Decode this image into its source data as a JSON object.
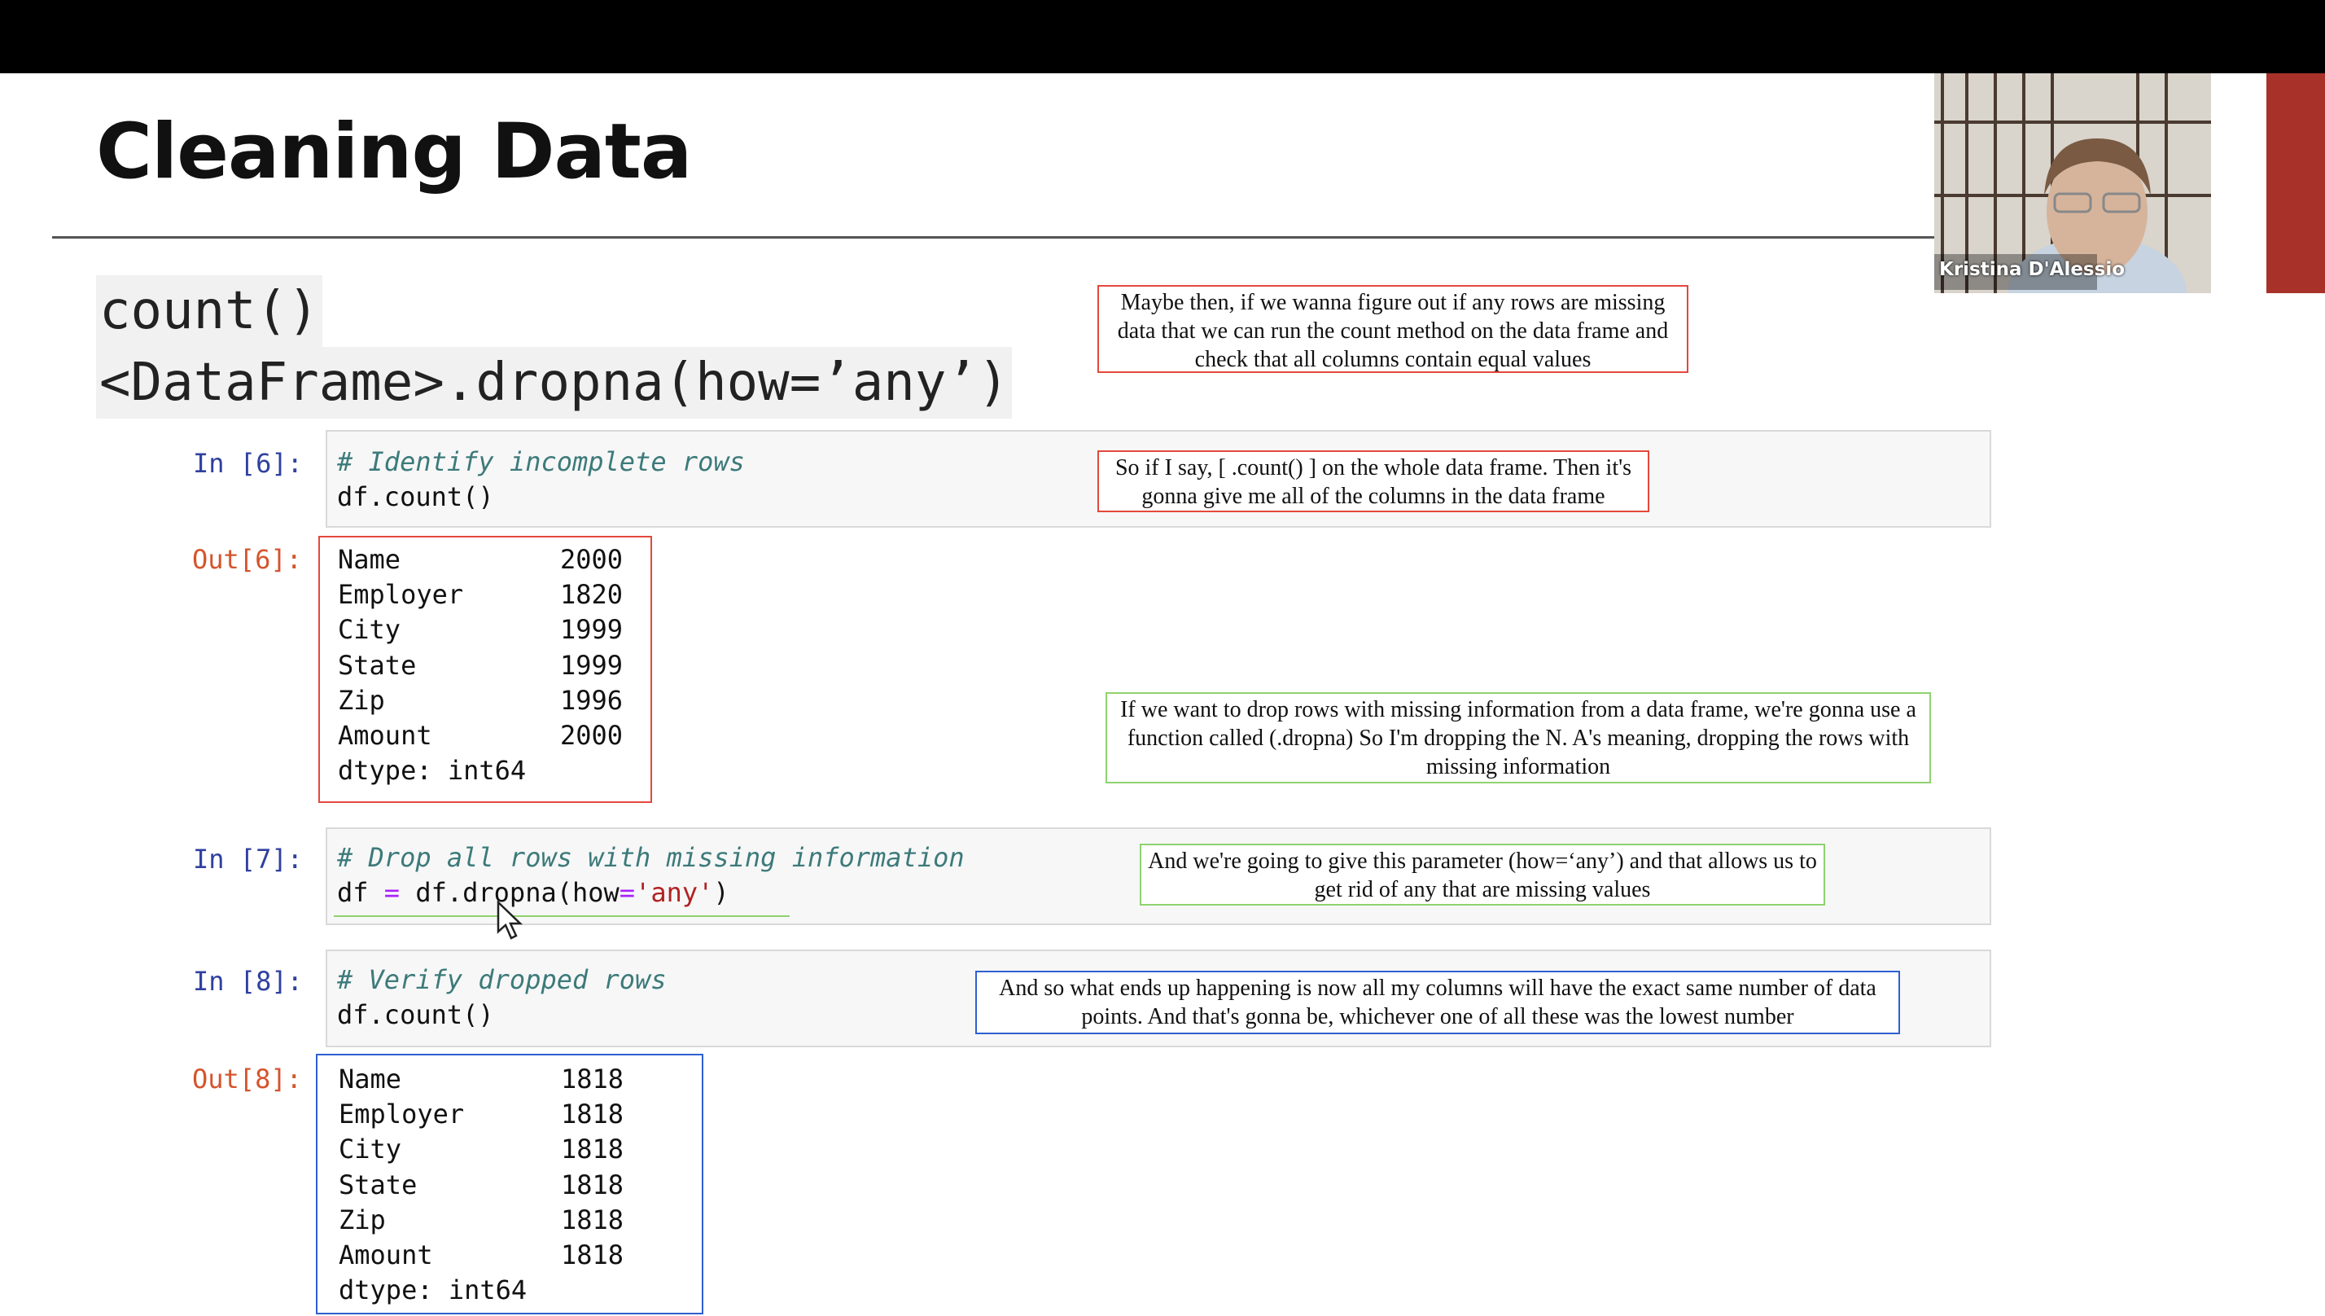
{
  "slide": {
    "title": "Cleaning Data",
    "methods": [
      "count()",
      "<DataFrame>.dropna(how=’any’)"
    ]
  },
  "webcam": {
    "speaker": "Kristina D'Alessio"
  },
  "cells": {
    "in6": {
      "prompt": "In [6]:",
      "comment": "# Identify incomplete rows",
      "code": "df.count()"
    },
    "out6": {
      "prompt": "Out[6]:",
      "rows": [
        {
          "name": "Name",
          "value": "2000"
        },
        {
          "name": "Employer",
          "value": "1820"
        },
        {
          "name": "City",
          "value": "1999"
        },
        {
          "name": "State",
          "value": "1999"
        },
        {
          "name": "Zip",
          "value": "1996"
        },
        {
          "name": "Amount",
          "value": "2000"
        }
      ],
      "dtype": "dtype: int64"
    },
    "in7": {
      "prompt": "In [7]:",
      "comment": "# Drop all rows with missing information",
      "code_var": "df",
      "code_op": "=",
      "code_call": "df.dropna(how",
      "code_eq": "=",
      "code_str": "'any'",
      "code_close": ")"
    },
    "in8": {
      "prompt": "In [8]:",
      "comment": "# Verify dropped rows",
      "code": "df.count()"
    },
    "out8": {
      "prompt": "Out[8]:",
      "rows": [
        {
          "name": "Name",
          "value": "1818"
        },
        {
          "name": "Employer",
          "value": "1818"
        },
        {
          "name": "City",
          "value": "1818"
        },
        {
          "name": "State",
          "value": "1818"
        },
        {
          "name": "Zip",
          "value": "1818"
        },
        {
          "name": "Amount",
          "value": "1818"
        }
      ],
      "dtype": "dtype: int64"
    }
  },
  "annotations": [
    {
      "color": "red",
      "text": "Maybe then, if we wanna figure out if any rows are missing data that we can run the count method on the data frame and check that all columns contain equal values"
    },
    {
      "color": "red",
      "text": "So if I say, [ .count() ] on the whole data frame. Then it's gonna give me all of the columns in the data frame"
    },
    {
      "color": "green",
      "text": "If we want to drop rows with missing information from a data frame, we're gonna use a function called (.dropna) So I'm dropping the N. A's meaning, dropping the rows with missing information"
    },
    {
      "color": "green",
      "text": "And we're going to give this parameter (how=‘any’) and that allows us to get rid of any that are missing values"
    },
    {
      "color": "blue",
      "text": "And so what ends up happening is now all my columns will have the exact same number of data points. And that's gonna be, whichever one of all these was the lowest number"
    }
  ],
  "colors": {
    "prompt_in": "#30409f",
    "prompt_out": "#d5542c",
    "annotation_red": "#e4483d",
    "annotation_green": "#8fd26f",
    "annotation_blue": "#2f5fd0",
    "comment": "#3d7a7a"
  },
  "icons": [
    "mouse-cursor-icon"
  ]
}
